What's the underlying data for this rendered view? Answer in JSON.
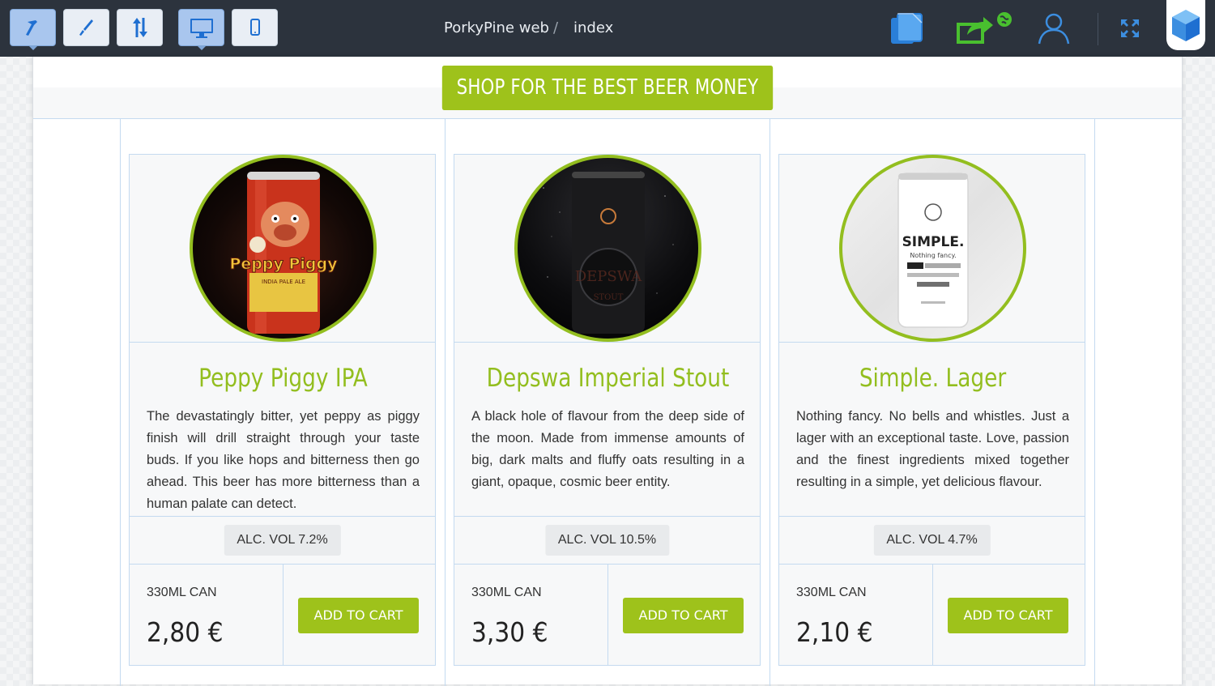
{
  "toolbar": {
    "tools": [
      {
        "name": "hammer-tool-button",
        "icon": "hammer-icon",
        "active": true
      },
      {
        "name": "brush-tool-button",
        "icon": "brush-icon",
        "active": false
      },
      {
        "name": "sort-tool-button",
        "icon": "up-down-arrows-icon",
        "active": false
      },
      {
        "name": "desktop-view-button",
        "icon": "desktop-icon",
        "active": true
      },
      {
        "name": "mobile-view-button",
        "icon": "mobile-icon",
        "active": false
      }
    ],
    "breadcrumb": {
      "project": "PorkyPine web",
      "separator": "/",
      "page": "index"
    },
    "right_icons": [
      "pages-icon",
      "publish-icon",
      "user-icon",
      "fullscreen-icon",
      "cube-logo-icon"
    ]
  },
  "hero": {
    "button_label": "SHOP FOR THE BEST BEER MONEY CAN BUY"
  },
  "colors": {
    "accent": "#9ec21b",
    "grid": "#c4daf0",
    "toolbar_bg": "#2c333d",
    "icon_blue": "#3c8ee0",
    "icon_green": "#4cbf3a"
  },
  "products": [
    {
      "title": "Peppy Piggy IPA",
      "description": "The devastatingly bitter, yet peppy as piggy finish will drill straight through your taste buds. If you like hops and bitterness then go ahead. This beer has more bitterness than a human palate can detect.",
      "alc": "ALC. VOL 7.2%",
      "size": "330ML CAN",
      "price": "2,80 €",
      "cart_label": "ADD TO CART",
      "can_text": "Peppy Piggy",
      "can_subtext": "INDIA PALE ALE"
    },
    {
      "title": "Depswa Imperial Stout",
      "description": "A black hole of flavour from the deep side of the moon. Made from immense amounts of big, dark malts and fluffy oats resulting in a giant, opaque, cosmic beer entity.",
      "alc": "ALC. VOL 10.5%",
      "size": "330ML CAN",
      "price": "3,30 €",
      "cart_label": "ADD TO CART",
      "can_text": "DEPSWA",
      "can_subtext": "STOUT"
    },
    {
      "title": "Simple. Lager",
      "description": "Nothing fancy. No bells and whistles. Just a lager with an exceptional taste. Love, passion and the finest ingredients mixed together resulting in a simple, yet delicious flavour.",
      "alc": "ALC. VOL 4.7%",
      "size": "330ML CAN",
      "price": "2,10 €",
      "cart_label": "ADD TO CART",
      "can_text": "SIMPLE.",
      "can_subtext": "Nothing fancy."
    }
  ]
}
